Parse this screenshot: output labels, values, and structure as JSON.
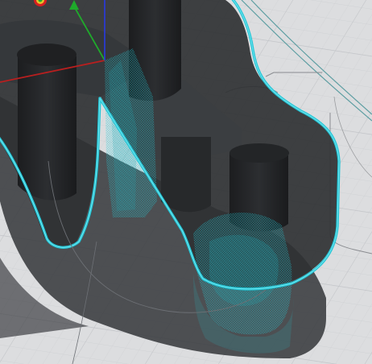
{
  "viewport": {
    "label": "",
    "background_color": "#dcdddf",
    "grid_color": "#c4c6ca",
    "grid_minor_color": "#cfd1d4",
    "part_color": "#2f3133",
    "part_top_color": "#3a3c3f",
    "hole_color": "#242628",
    "toolpath_color": "#1fc7d8",
    "toolpath_dim_color": "#1e8f95",
    "axis_x_color": "#b81f1f",
    "axis_y_color": "#1faa2b",
    "axis_z_color": "#2a3ad0",
    "origin_marker_color": "#d62020"
  },
  "icons": {
    "axis_triad": "axis-triad-icon",
    "origin_marker": "origin-marker-icon"
  }
}
